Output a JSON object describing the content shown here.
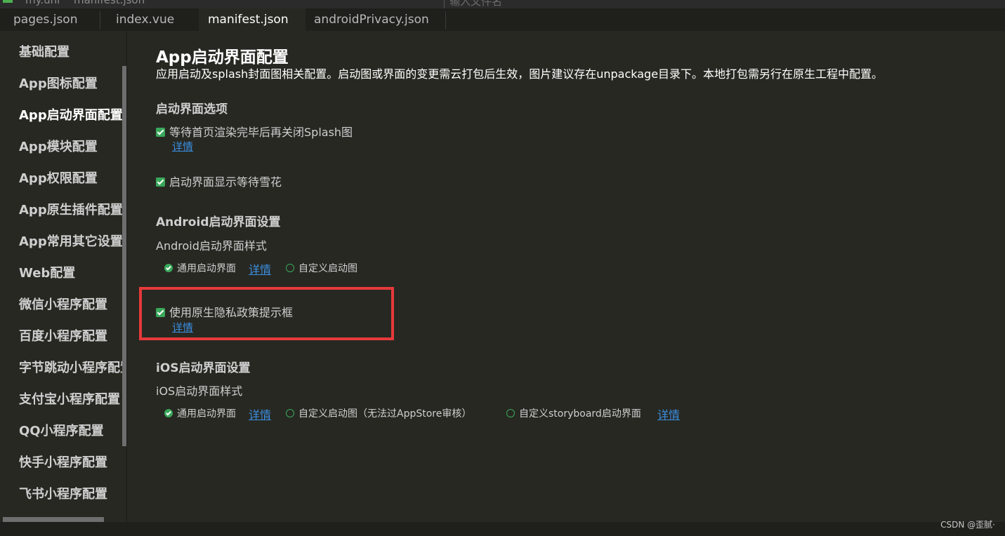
{
  "window": {
    "title_project": "my.uni",
    "title_file": "manifest.json",
    "search_hint": "输入文件名"
  },
  "tabs": [
    {
      "label": "pages.json"
    },
    {
      "label": "index.vue"
    },
    {
      "label": "manifest.json",
      "active": true
    },
    {
      "label": "androidPrivacy.json"
    }
  ],
  "sidebar": {
    "items": [
      {
        "label": "基础配置"
      },
      {
        "label": "App图标配置"
      },
      {
        "label": "App启动界面配置",
        "active": true
      },
      {
        "label": "App模块配置"
      },
      {
        "label": "App权限配置"
      },
      {
        "label": "App原生插件配置"
      },
      {
        "label": "App常用其它设置"
      },
      {
        "label": "Web配置"
      },
      {
        "label": "微信小程序配置"
      },
      {
        "label": "百度小程序配置"
      },
      {
        "label": "字节跳动小程序配置"
      },
      {
        "label": "支付宝小程序配置"
      },
      {
        "label": "QQ小程序配置"
      },
      {
        "label": "快手小程序配置"
      },
      {
        "label": "飞书小程序配置"
      }
    ]
  },
  "main": {
    "title": "App启动界面配置",
    "description": "应用启动及splash封面图相关配置。启动图或界面的变更需云打包后生效，图片建议存在unpackage目录下。本地打包需另行在原生工程中配置。",
    "splash_options": {
      "heading": "启动界面选项",
      "wait_render": {
        "label": "等待首页渲染完毕后再关闭Splash图",
        "checked": true,
        "link": "详情"
      },
      "show_snow": {
        "label": "启动界面显示等待雪花",
        "checked": true
      }
    },
    "android": {
      "heading": "Android启动界面设置",
      "style_label": "Android启动界面样式",
      "options": [
        {
          "label": "通用启动界面",
          "selected": true,
          "link": "详情"
        },
        {
          "label": "自定义启动图",
          "selected": false
        }
      ],
      "privacy": {
        "label": "使用原生隐私政策提示框",
        "checked": true,
        "link": "详情"
      }
    },
    "ios": {
      "heading": "iOS启动界面设置",
      "style_label": "iOS启动界面样式",
      "options": [
        {
          "label": "通用启动界面",
          "selected": true,
          "link": "详情"
        },
        {
          "label": "自定义启动图（无法过AppStore审核）",
          "selected": false
        },
        {
          "label": "自定义storyboard启动界面",
          "selected": false,
          "link": "详情"
        }
      ]
    }
  },
  "watermark": "CSDN @歪腻·",
  "colors": {
    "accent_green": "#3aa85b",
    "link_blue": "#3b8ee0",
    "highlight_red": "#e5393b",
    "background": "#272822"
  }
}
